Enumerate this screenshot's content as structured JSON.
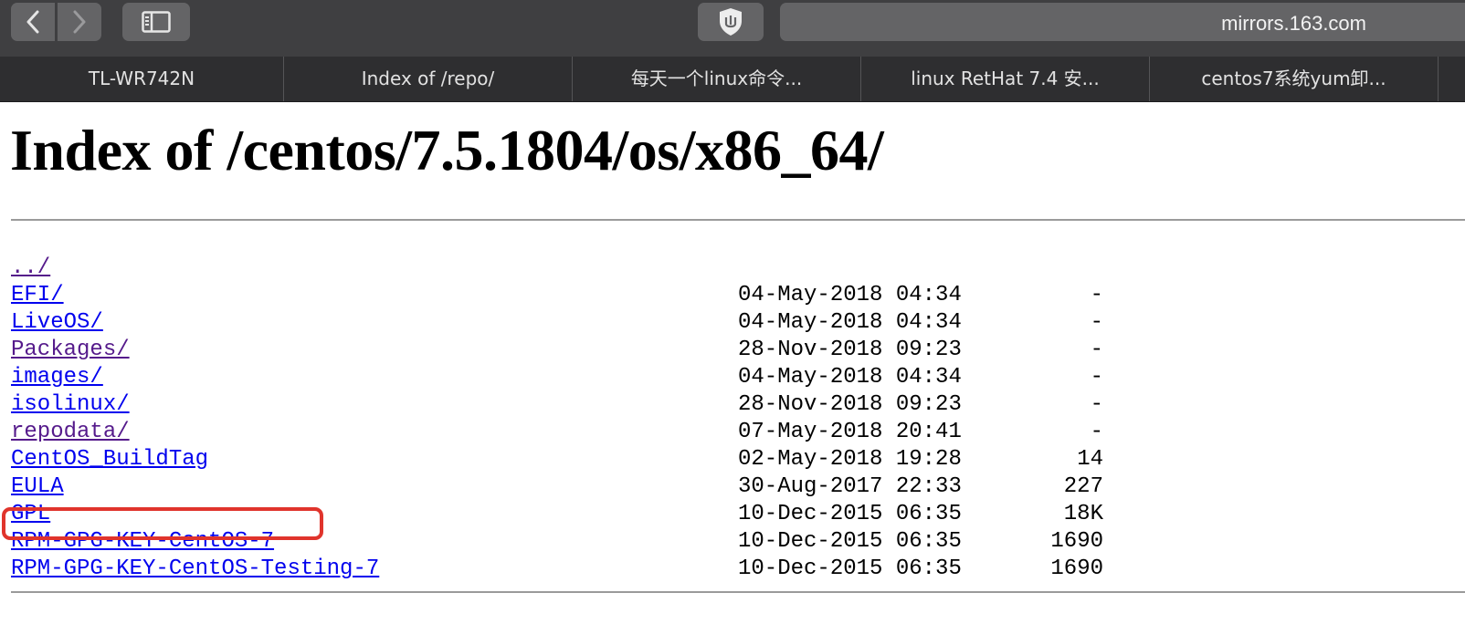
{
  "browser": {
    "address": "mirrors.163.com",
    "tabs": [
      {
        "label": "TL-WR742N"
      },
      {
        "label": "Index of /repo/"
      },
      {
        "label": "每天一个linux命令..."
      },
      {
        "label": "linux RetHat 7.4 安..."
      },
      {
        "label": "centos7系统yum卸..."
      }
    ]
  },
  "page": {
    "title": "Index of /centos/7.5.1804/os/x86_64/",
    "parent_link": "../",
    "entries": [
      {
        "name": "EFI/",
        "date": "04-May-2018 04:34",
        "size": "-",
        "visited": false
      },
      {
        "name": "LiveOS/",
        "date": "04-May-2018 04:34",
        "size": "-",
        "visited": false
      },
      {
        "name": "Packages/",
        "date": "28-Nov-2018 09:23",
        "size": "-",
        "visited": true
      },
      {
        "name": "images/",
        "date": "04-May-2018 04:34",
        "size": "-",
        "visited": false
      },
      {
        "name": "isolinux/",
        "date": "28-Nov-2018 09:23",
        "size": "-",
        "visited": false
      },
      {
        "name": "repodata/",
        "date": "07-May-2018 20:41",
        "size": "-",
        "visited": true
      },
      {
        "name": "CentOS_BuildTag",
        "date": "02-May-2018 19:28",
        "size": "14",
        "visited": false
      },
      {
        "name": "EULA",
        "date": "30-Aug-2017 22:33",
        "size": "227",
        "visited": false
      },
      {
        "name": "GPL",
        "date": "10-Dec-2015 06:35",
        "size": "18K",
        "visited": false
      },
      {
        "name": "RPM-GPG-KEY-CentOS-7",
        "date": "10-Dec-2015 06:35",
        "size": "1690",
        "visited": false
      },
      {
        "name": "RPM-GPG-KEY-CentOS-Testing-7",
        "date": "10-Dec-2015 06:35",
        "size": "1690",
        "visited": false
      }
    ]
  },
  "icons": {
    "back": "chevron-left-icon",
    "forward": "chevron-right-icon",
    "sidebar": "sidebar-icon",
    "extension": "ublock-shield-icon"
  },
  "colors": {
    "link": "#0000ee",
    "visited": "#551a8b",
    "highlight_box": "#e0342c"
  }
}
